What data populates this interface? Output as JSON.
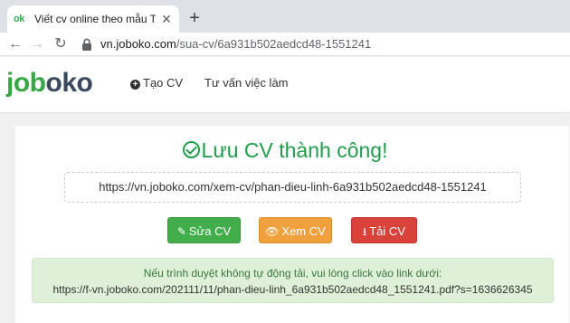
{
  "browser": {
    "tab_title": "Viết cv online theo mẫu Trẻ trung",
    "tab_favicon": "ok",
    "url_host": "vn.joboko.com",
    "url_path": "/sua-cv/6a931b502aedcd48-1551241"
  },
  "header": {
    "logo_part1": "job",
    "logo_part2": "oko",
    "menu": {
      "create_cv": "Tạo CV",
      "career_advice": "Tư vấn việc làm"
    }
  },
  "main": {
    "title": "Lưu CV thành công!",
    "cv_link": "https://vn.joboko.com/xem-cv/phan-dieu-linh-6a931b502aedcd48-1551241",
    "buttons": {
      "edit": "Sửa CV",
      "view": "Xem CV",
      "download": "Tải CV"
    },
    "notice": {
      "message": "Nếu trình duyệt không tự động tải, vui lòng click vào link dưới:",
      "link": "https://f-vn.joboko.com/202111/11/phan-dieu-linh_6a931b502aedcd48_1551241.pdf?s=1636626345"
    }
  },
  "colors": {
    "success_green": "#1f9d4a",
    "edit_button": "#42ad4b",
    "view_button": "#f0a13e",
    "download_button": "#d9413b",
    "notice_bg": "#dff0d8"
  },
  "icons": {
    "tab_close": "close-icon",
    "new_tab": "plus-icon",
    "back": "arrow-left-icon",
    "forward": "arrow-right-icon",
    "reload": "reload-icon",
    "lock": "lock-icon",
    "title_check": "check-circle-icon",
    "edit": "edit-icon",
    "view": "eye-icon",
    "download": "download-icon"
  }
}
